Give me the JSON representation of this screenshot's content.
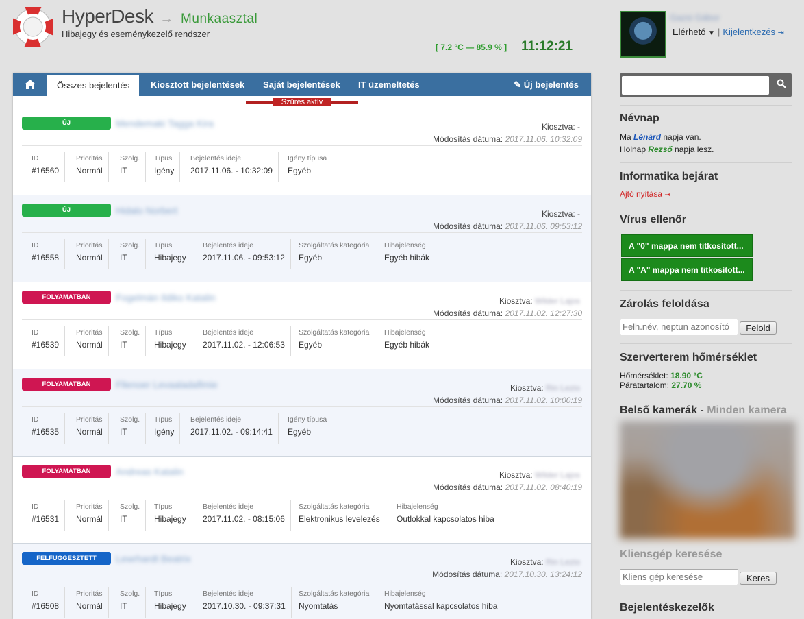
{
  "header": {
    "brand": "HyperDesk",
    "arrow": "→",
    "module": "Munkaasztal",
    "tagline": "Hibajegy és eseménykezelő rendszer",
    "climate": "[ 7.2 °C — 85.9 % ]",
    "clock": "11:12:21"
  },
  "user": {
    "name": "Gazsi Gábor",
    "status": "Elérhető",
    "logout_label": "Kijelentkezés"
  },
  "nav": {
    "tabs": [
      "Összes bejelentés",
      "Kiosztott bejelentések",
      "Saját bejelentések",
      "IT üzemeltetés"
    ],
    "new_ticket": "Új bejelentés",
    "filter_badge": "Szűrés aktív"
  },
  "tickets": [
    {
      "status": "ÚJ",
      "title": "Mendemaki Tagga Kira",
      "assigned_label": "Kiosztva:",
      "assigned_to": "-",
      "mod_label": "Módosítás dátuma:",
      "mod_date": "2017.11.06. 10:32:09",
      "fields": [
        {
          "h": "ID",
          "v": "#16560"
        },
        {
          "h": "Prioritás",
          "v": "Normál"
        },
        {
          "h": "Szolg.",
          "v": "IT"
        },
        {
          "h": "Típus",
          "v": "Igény"
        },
        {
          "h": "Bejelentés ideje",
          "v": "2017.11.06. - 10:32:09"
        },
        {
          "h": "Igény típusa",
          "v": "Egyéb"
        }
      ]
    },
    {
      "status": "ÚJ",
      "title": "Hidalo Norbert",
      "assigned_label": "Kiosztva:",
      "assigned_to": "-",
      "mod_label": "Módosítás dátuma:",
      "mod_date": "2017.11.06. 09:53:12",
      "fields": [
        {
          "h": "ID",
          "v": "#16558"
        },
        {
          "h": "Prioritás",
          "v": "Normál"
        },
        {
          "h": "Szolg.",
          "v": "IT"
        },
        {
          "h": "Típus",
          "v": "Hibajegy"
        },
        {
          "h": "Bejelentés ideje",
          "v": "2017.11.06. - 09:53:12"
        },
        {
          "h": "Szolgáltatás kategória",
          "v": "Egyéb"
        },
        {
          "h": "Hibajelenség",
          "v": "Egyéb hibák"
        }
      ]
    },
    {
      "status": "FOLYAMATBAN",
      "title": "Fogelmán Ildiko Katalin",
      "assigned_label": "Kiosztva:",
      "assigned_to": "Wilder Lajos",
      "mod_label": "Módosítás dátuma:",
      "mod_date": "2017.11.02. 12:27:30",
      "fields": [
        {
          "h": "ID",
          "v": "#16539"
        },
        {
          "h": "Prioritás",
          "v": "Normál"
        },
        {
          "h": "Szolg.",
          "v": "IT"
        },
        {
          "h": "Típus",
          "v": "Hibajegy"
        },
        {
          "h": "Bejelentés ideje",
          "v": "2017.11.02. - 12:06:53"
        },
        {
          "h": "Szolgáltatás kategória",
          "v": "Egyéb"
        },
        {
          "h": "Hibajelenség",
          "v": "Egyéb hibák"
        }
      ]
    },
    {
      "status": "FOLYAMATBAN",
      "title": "Fllenoer Levaaladaflmie",
      "assigned_label": "Kiosztva:",
      "assigned_to": "Rin Lezio",
      "mod_label": "Módosítás dátuma:",
      "mod_date": "2017.11.02. 10:00:19",
      "fields": [
        {
          "h": "ID",
          "v": "#16535"
        },
        {
          "h": "Prioritás",
          "v": "Normál"
        },
        {
          "h": "Szolg.",
          "v": "IT"
        },
        {
          "h": "Típus",
          "v": "Igény"
        },
        {
          "h": "Bejelentés ideje",
          "v": "2017.11.02. - 09:14:41"
        },
        {
          "h": "Igény típusa",
          "v": "Egyéb"
        }
      ]
    },
    {
      "status": "FOLYAMATBAN",
      "title": "Andreas Katalin",
      "assigned_label": "Kiosztva:",
      "assigned_to": "Wilder Lajos",
      "mod_label": "Módosítás dátuma:",
      "mod_date": "2017.11.02. 08:40:19",
      "fields": [
        {
          "h": "ID",
          "v": "#16531"
        },
        {
          "h": "Prioritás",
          "v": "Normál"
        },
        {
          "h": "Szolg.",
          "v": "IT"
        },
        {
          "h": "Típus",
          "v": "Hibajegy"
        },
        {
          "h": "Bejelentés ideje",
          "v": "2017.11.02. - 08:15:06"
        },
        {
          "h": "Szolgáltatás kategória",
          "v": "Elektronikus levelezés"
        },
        {
          "h": "Hibajelenség",
          "v": "Outlokkal kapcsolatos hiba"
        }
      ]
    },
    {
      "status": "FELFÜGGESZTETT",
      "title": "Lewrhardt Beatrix",
      "assigned_label": "Kiosztva:",
      "assigned_to": "Rin Lezio",
      "mod_label": "Módosítás dátuma:",
      "mod_date": "2017.10.30. 13:24:12",
      "fields": [
        {
          "h": "ID",
          "v": "#16508"
        },
        {
          "h": "Prioritás",
          "v": "Normál"
        },
        {
          "h": "Szolg.",
          "v": "IT"
        },
        {
          "h": "Típus",
          "v": "Hibajegy"
        },
        {
          "h": "Bejelentés ideje",
          "v": "2017.10.30. - 09:37:31"
        },
        {
          "h": "Szolgáltatás kategória",
          "v": "Nyomtatás"
        },
        {
          "h": "Hibajelenség",
          "v": "Nyomtatással kapcsolatos hiba"
        }
      ]
    }
  ],
  "sidebar": {
    "search_placeholder": "",
    "nameday": {
      "title": "Névnap",
      "today_pre": "Ma ",
      "today_name": "Lénárd",
      "today_post": " napja van.",
      "tomorrow_pre": "Holnap ",
      "tomorrow_name": "Rezső",
      "tomorrow_post": " napja lesz."
    },
    "door": {
      "title": "Informatika bejárat",
      "link": "Ajtó nyitása"
    },
    "virus": {
      "title": "Vírus ellenőr",
      "buttons": [
        "A \"0\" mappa nem titkosított...",
        "A \"A\" mappa nem titkosított..."
      ]
    },
    "unlock": {
      "title": "Zárolás feloldása",
      "placeholder": "Felh.név, neptun azonosító",
      "button": "Felold"
    },
    "server": {
      "title": "Szerverterem hőmérséklet",
      "temp_label": "Hőmérséklet:",
      "temp_value": "18.90 °C",
      "hum_label": "Páratartalom:",
      "hum_value": "27.70 %"
    },
    "cameras": {
      "title": "Belső kamerák -",
      "all": "Minden kamera"
    },
    "client": {
      "title": "Kliensgép keresése",
      "placeholder": "Kliens gép keresése",
      "button": "Keres"
    },
    "handlers": {
      "title": "Bejelentéskezelők"
    }
  },
  "colors": {
    "nav_bg": "#3a6fa0",
    "status_new": "#27b04b",
    "status_in_progress": "#cf1652",
    "status_suspended": "#1565c8",
    "virus_button": "#1c8a1c"
  }
}
